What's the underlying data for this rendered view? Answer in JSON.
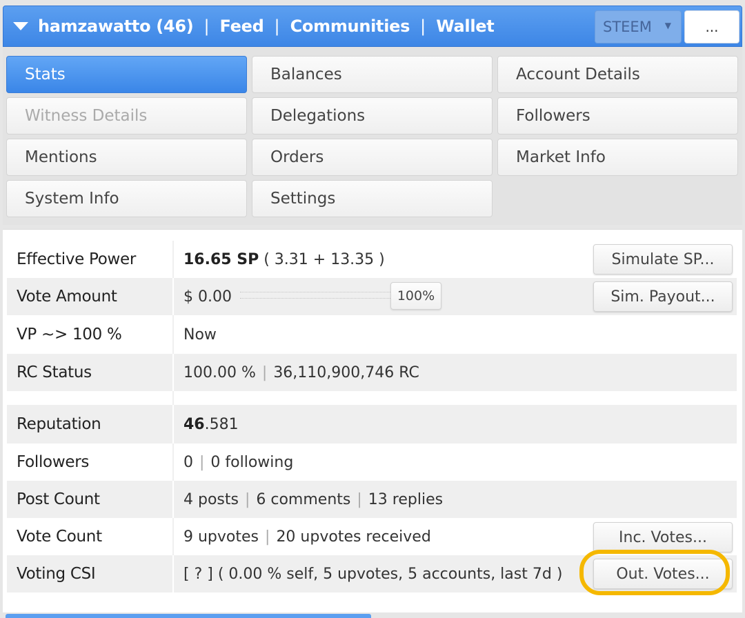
{
  "header": {
    "username": "hamzawatto (46)",
    "sep": "|",
    "nav": [
      "Feed",
      "Communities",
      "Wallet"
    ],
    "coin": "STEEM",
    "more": "..."
  },
  "tabs": [
    {
      "label": "Stats",
      "state": "active"
    },
    {
      "label": "Balances",
      "state": "normal"
    },
    {
      "label": "Account Details",
      "state": "normal"
    },
    {
      "label": "Witness Details",
      "state": "disabled"
    },
    {
      "label": "Delegations",
      "state": "normal"
    },
    {
      "label": "Followers",
      "state": "normal"
    },
    {
      "label": "Mentions",
      "state": "normal"
    },
    {
      "label": "Orders",
      "state": "normal"
    },
    {
      "label": "Market Info",
      "state": "normal"
    },
    {
      "label": "System Info",
      "state": "normal"
    },
    {
      "label": "Settings",
      "state": "normal"
    }
  ],
  "stats": {
    "effective_power": {
      "label": "Effective Power",
      "value_bold": "16.65 SP",
      "value_rest": " ( 3.31 + 13.35 )",
      "button": "Simulate SP..."
    },
    "vote_amount": {
      "label": "Vote Amount",
      "value": "$ 0.00",
      "percent": "100%",
      "button": "Sim. Payout..."
    },
    "vp": {
      "label": "VP ~> 100 %",
      "value": "Now"
    },
    "rc": {
      "label": "RC Status",
      "pct": "100.00 %",
      "amount": "36,110,900,746 RC"
    },
    "reputation": {
      "label": "Reputation",
      "int": "46",
      "dec": ".581"
    },
    "followers": {
      "label": "Followers",
      "count": "0",
      "following": "0 following"
    },
    "post_count": {
      "label": "Post Count",
      "posts": "4 posts",
      "comments": "6 comments",
      "replies": "13 replies"
    },
    "vote_count": {
      "label": "Vote Count",
      "upvotes": "9 upvotes",
      "received": "20 upvotes received",
      "button": "Inc. Votes..."
    },
    "voting_csi": {
      "label": "Voting CSI",
      "value": "[ ? ] ( 0.00 % self, 5 upvotes, 5 accounts, last 7d )",
      "button": "Out. Votes..."
    }
  },
  "colors": {
    "accent": "#3d86e6",
    "highlight": "#f5b800"
  }
}
